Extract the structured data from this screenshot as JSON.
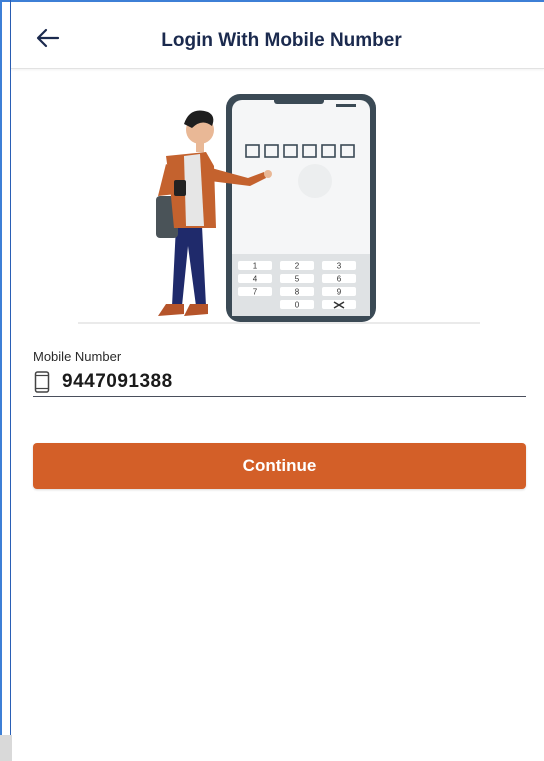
{
  "app_bar": {
    "back_icon": "arrow-left-icon",
    "title": "Login With Mobile Number"
  },
  "form": {
    "mobile_label": "Mobile Number",
    "mobile_icon": "mobile-phone-icon",
    "mobile_value": "9447091388"
  },
  "illustration": {
    "keypad_keys": [
      "1",
      "2",
      "3",
      "4",
      "5",
      "6",
      "7",
      "8",
      "9",
      "0"
    ]
  },
  "actions": {
    "continue_label": "Continue"
  },
  "colors": {
    "primary_button": "#d35f28",
    "title_text": "#1b2a4e"
  }
}
